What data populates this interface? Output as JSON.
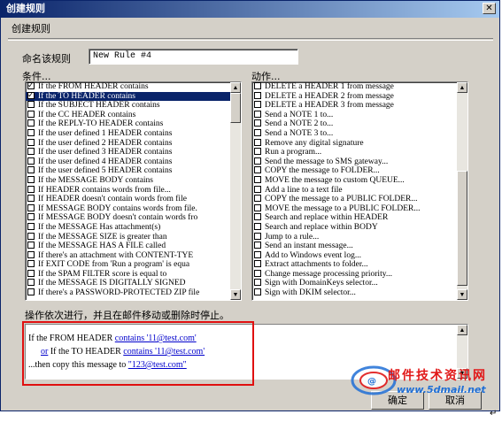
{
  "window": {
    "title": "创建规则",
    "close_glyph": "✕"
  },
  "group": {
    "title": "创建规则"
  },
  "rule_name": {
    "label": "命名该规则",
    "value": "New Rule #4"
  },
  "conditions": {
    "label": "条件...",
    "items": [
      {
        "label": "If the FROM HEADER contains",
        "checked": true,
        "selected": false
      },
      {
        "label": "If the TO HEADER contains",
        "checked": true,
        "selected": true
      },
      {
        "label": "If the SUBJECT HEADER contains",
        "checked": false,
        "selected": false
      },
      {
        "label": "If the CC HEADER contains",
        "checked": false,
        "selected": false
      },
      {
        "label": "If the REPLY-TO HEADER contains",
        "checked": false,
        "selected": false
      },
      {
        "label": "If the user defined 1 HEADER contains",
        "checked": false,
        "selected": false
      },
      {
        "label": "If the user defined 2 HEADER contains",
        "checked": false,
        "selected": false
      },
      {
        "label": "If the user defined 3 HEADER contains",
        "checked": false,
        "selected": false
      },
      {
        "label": "If the user defined 4 HEADER contains",
        "checked": false,
        "selected": false
      },
      {
        "label": "If the user defined 5 HEADER contains",
        "checked": false,
        "selected": false
      },
      {
        "label": "If the MESSAGE BODY contains",
        "checked": false,
        "selected": false
      },
      {
        "label": "If HEADER contains words from file...",
        "checked": false,
        "selected": false
      },
      {
        "label": "If HEADER doesn't contain words from file",
        "checked": false,
        "selected": false
      },
      {
        "label": "If MESSAGE BODY contains words from file.",
        "checked": false,
        "selected": false
      },
      {
        "label": "If MESSAGE BODY doesn't contain words fro",
        "checked": false,
        "selected": false
      },
      {
        "label": "If the MESSAGE Has attachment(s)",
        "checked": false,
        "selected": false
      },
      {
        "label": "If the MESSAGE SIZE is greater than",
        "checked": false,
        "selected": false
      },
      {
        "label": "If the MESSAGE HAS A FILE called",
        "checked": false,
        "selected": false
      },
      {
        "label": "If there's an attachment with CONTENT-TYE",
        "checked": false,
        "selected": false
      },
      {
        "label": "If EXIT CODE from 'Run a program' is equa",
        "checked": false,
        "selected": false
      },
      {
        "label": "If the SPAM FILTER score is equal to",
        "checked": false,
        "selected": false
      },
      {
        "label": "If the MESSAGE IS DIGITALLY SIGNED",
        "checked": false,
        "selected": false
      },
      {
        "label": "If there's a PASSWORD-PROTECTED ZIP file",
        "checked": false,
        "selected": false
      }
    ]
  },
  "actions": {
    "label": "动作...",
    "items": [
      {
        "label": "DELETE a HEADER 1 from message",
        "checked": false
      },
      {
        "label": "DELETE a HEADER 2 from message",
        "checked": false
      },
      {
        "label": "DELETE a HEADER 3 from message",
        "checked": false
      },
      {
        "label": "Send a NOTE 1 to...",
        "checked": false
      },
      {
        "label": "Send a NOTE 2 to...",
        "checked": false
      },
      {
        "label": "Send a NOTE 3 to...",
        "checked": false
      },
      {
        "label": "Remove any digital signature",
        "checked": false
      },
      {
        "label": "Run a program...",
        "checked": false
      },
      {
        "label": "Send the message to SMS gateway...",
        "checked": false
      },
      {
        "label": "COPY the message to FOLDER...",
        "checked": false
      },
      {
        "label": "MOVE the message to custom QUEUE...",
        "checked": false
      },
      {
        "label": "Add a line to a text file",
        "checked": false
      },
      {
        "label": "COPY the message to a PUBLIC FOLDER...",
        "checked": false
      },
      {
        "label": "MOVE the message to a PUBLIC FOLDER...",
        "checked": false
      },
      {
        "label": "Search and replace within HEADER",
        "checked": false
      },
      {
        "label": "Search and replace within BODY",
        "checked": false
      },
      {
        "label": "Jump to a rule...",
        "checked": false
      },
      {
        "label": "Send an instant message...",
        "checked": false
      },
      {
        "label": "Add to Windows event log...",
        "checked": false
      },
      {
        "label": "Extract attachments to folder...",
        "checked": false
      },
      {
        "label": "Change message processing priority...",
        "checked": false
      },
      {
        "label": "Sign with DomainKeys selector...",
        "checked": false
      },
      {
        "label": "Sign with DKIM selector...",
        "checked": false
      }
    ]
  },
  "description": {
    "label": "操作依次进行，并且在邮件移动或删除时停止。",
    "line1": {
      "prefix": "If the FROM HEADER ",
      "link": "contains '11@test.com'"
    },
    "line2": {
      "prefix_link": "or",
      "mid": " If the TO HEADER ",
      "link": "contains '11@test.com'"
    },
    "line3": {
      "prefix": "...then copy this message to ",
      "link": "\"123@test.com\""
    }
  },
  "buttons": {
    "ok": "确定",
    "cancel": "取消"
  },
  "watermark": {
    "line1": "邮件技术资讯网",
    "line2": "www.5dmail.net"
  },
  "colors": {
    "highlight": "#e01010",
    "title_start": "#0a246a",
    "link": "#0000cc",
    "selection": "#0a246a"
  }
}
